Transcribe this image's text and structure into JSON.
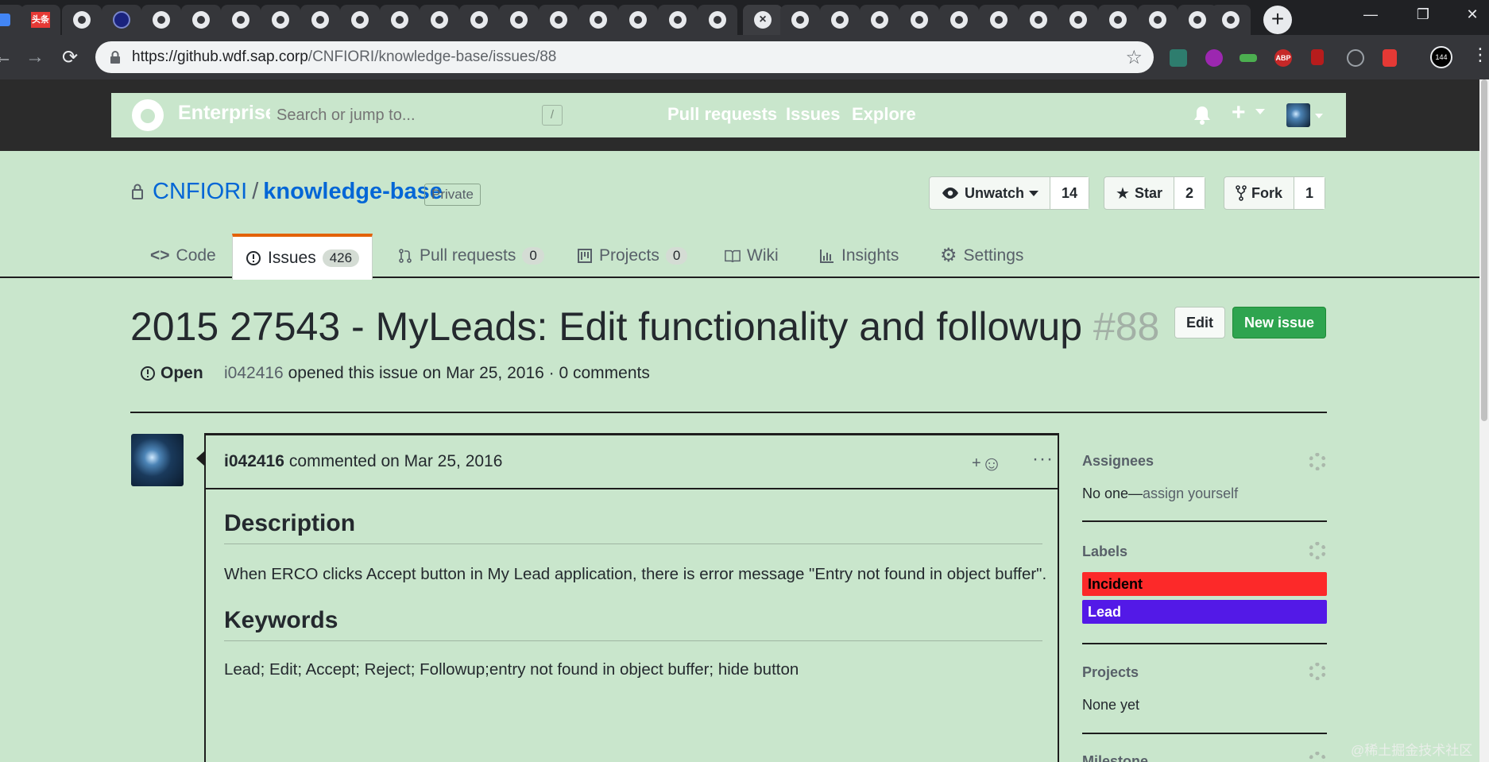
{
  "browser": {
    "url_host": "https://github.wdf.sap.corp",
    "url_path": "/CNFIORI/knowledge-base/issues/88",
    "toutiao_tab_label": "头条",
    "extension_badge": "144"
  },
  "header": {
    "brand": "Enterprise",
    "search_placeholder": "Search or jump to...",
    "search_shortcut": "/",
    "nav": [
      "Pull requests",
      "Issues",
      "Explore"
    ]
  },
  "repo": {
    "owner": "CNFIORI",
    "separator": "/",
    "name": "knowledge-base",
    "visibility": "Private",
    "watch": {
      "label": "Unwatch",
      "count": "14"
    },
    "star": {
      "label": "Star",
      "count": "2"
    },
    "fork": {
      "label": "Fork",
      "count": "1"
    }
  },
  "tabs": [
    {
      "label": "Code"
    },
    {
      "label": "Issues",
      "count": "426"
    },
    {
      "label": "Pull requests",
      "count": "0"
    },
    {
      "label": "Projects",
      "count": "0"
    },
    {
      "label": "Wiki"
    },
    {
      "label": "Insights"
    },
    {
      "label": "Settings"
    }
  ],
  "issue": {
    "title": "2015 27543 - MyLeads: Edit functionality and followup",
    "number": "#88",
    "state": "Open",
    "author": "i042416",
    "meta": "opened this issue on Mar 25, 2016 · 0 comments",
    "edit_label": "Edit",
    "new_issue_label": "New issue"
  },
  "comment": {
    "author": "i042416",
    "meta": "commented on Mar 25, 2016",
    "react": "+",
    "more": "···",
    "sections": [
      {
        "heading": "Description",
        "text": "When ERCO clicks Accept button in My Lead application, there is error message \"Entry not found in object buffer\"."
      },
      {
        "heading": "Keywords",
        "text": "Lead; Edit; Accept; Reject; Followup;entry not found in object buffer; hide button"
      }
    ]
  },
  "sidebar": {
    "assignees": {
      "title": "Assignees",
      "none": "No one—",
      "action": "assign yourself"
    },
    "labels": {
      "title": "Labels",
      "items": [
        {
          "name": "Incident",
          "color": "#fc2929",
          "text_color": "#000000"
        },
        {
          "name": "Lead",
          "color": "#5319e7",
          "text_color": "#ffffff"
        }
      ]
    },
    "projects": {
      "title": "Projects",
      "value": "None yet"
    },
    "milestone": {
      "title": "Milestone"
    }
  },
  "watermark": "@稀土掘金技术社区"
}
